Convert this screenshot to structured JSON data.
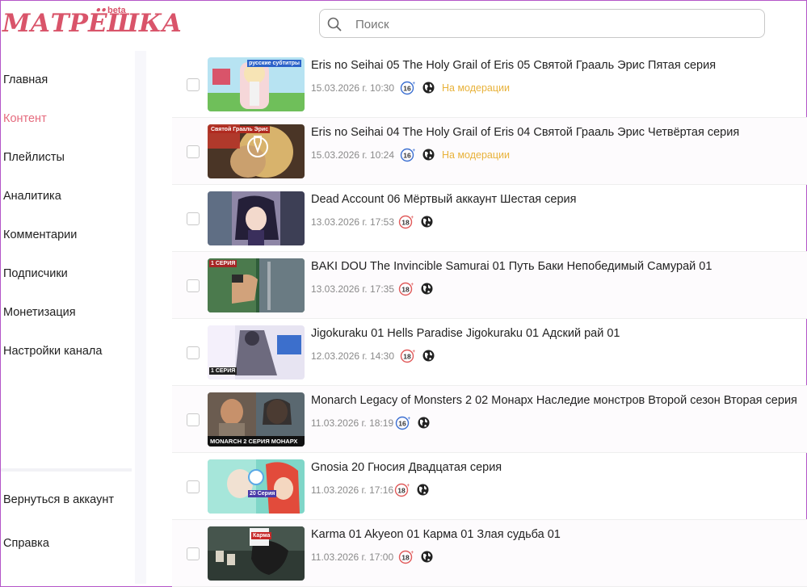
{
  "brand": {
    "logo_text": "МАТРЁШКА",
    "badge": "beta",
    "colors": {
      "accent": "#e56b7e",
      "moderation": "#e8b23a",
      "age16": "#3b6fd1",
      "age18": "#e05a5a"
    }
  },
  "search": {
    "placeholder": "Поиск"
  },
  "sidebar": {
    "items": [
      {
        "label": "Главная"
      },
      {
        "label": "Контент"
      },
      {
        "label": "Плейлисты"
      },
      {
        "label": "Аналитика"
      },
      {
        "label": "Комментарии"
      },
      {
        "label": "Подписчики"
      },
      {
        "label": "Монетизация"
      },
      {
        "label": "Настройки канала"
      }
    ],
    "active_item": "Контент",
    "bottom": [
      {
        "label": "Вернуться в аккаунт"
      },
      {
        "label": "Справка"
      }
    ]
  },
  "videos": [
    {
      "title": "Eris no Seihai 05 The Holy Grail of Eris 05 Святой Грааль Эрис Пятая серия",
      "date": "15.03.2026 г. 10:30",
      "age": "16",
      "status": "На модерации",
      "thumb_label": "русские субтитры"
    },
    {
      "title": "Eris no Seihai 04 The Holy Grail of Eris 04 Святой Грааль Эрис Четвёртая серия",
      "date": "15.03.2026 г. 10:24",
      "age": "16",
      "status": "На модерации",
      "thumb_label": "Святой Грааль Эрис"
    },
    {
      "title": "Dead Account 06 Мёртвый аккаунт Шестая серия",
      "date": "13.03.2026 г. 17:53",
      "age": "18",
      "status": "",
      "thumb_label": ""
    },
    {
      "title": "BAKI DOU The Invincible Samurai 01 Путь Баки Непобедимый Самурай 01",
      "date": "13.03.2026 г. 17:35",
      "age": "18",
      "status": "",
      "thumb_label": "1 СЕРИЯ"
    },
    {
      "title": "Jigokuraku 01 Hells Paradise Jigokuraku 01 Адский рай 01",
      "date": "12.03.2026 г. 14:30",
      "age": "18",
      "status": "",
      "thumb_label": "1 СЕРИЯ"
    },
    {
      "title": "Monarch Legacy of Monsters 2 02 Монарх Наследие монстров Второй сезон Вторая серия",
      "date": "11.03.2026 г. 18:19",
      "age": "16",
      "status": "",
      "thumb_label": "MONARCH 2 СЕРИЯ МОНАРХ"
    },
    {
      "title": "Gnosia 20 Гносия Двадцатая серия",
      "date": "11.03.2026 г. 17:16",
      "age": "18",
      "status": "",
      "thumb_label": "20 Серия"
    },
    {
      "title": "Karma 01 Akyeon 01 Карма 01 Злая судьба 01",
      "date": "11.03.2026 г. 17:00",
      "age": "18",
      "status": "",
      "thumb_label": "Карма"
    }
  ]
}
